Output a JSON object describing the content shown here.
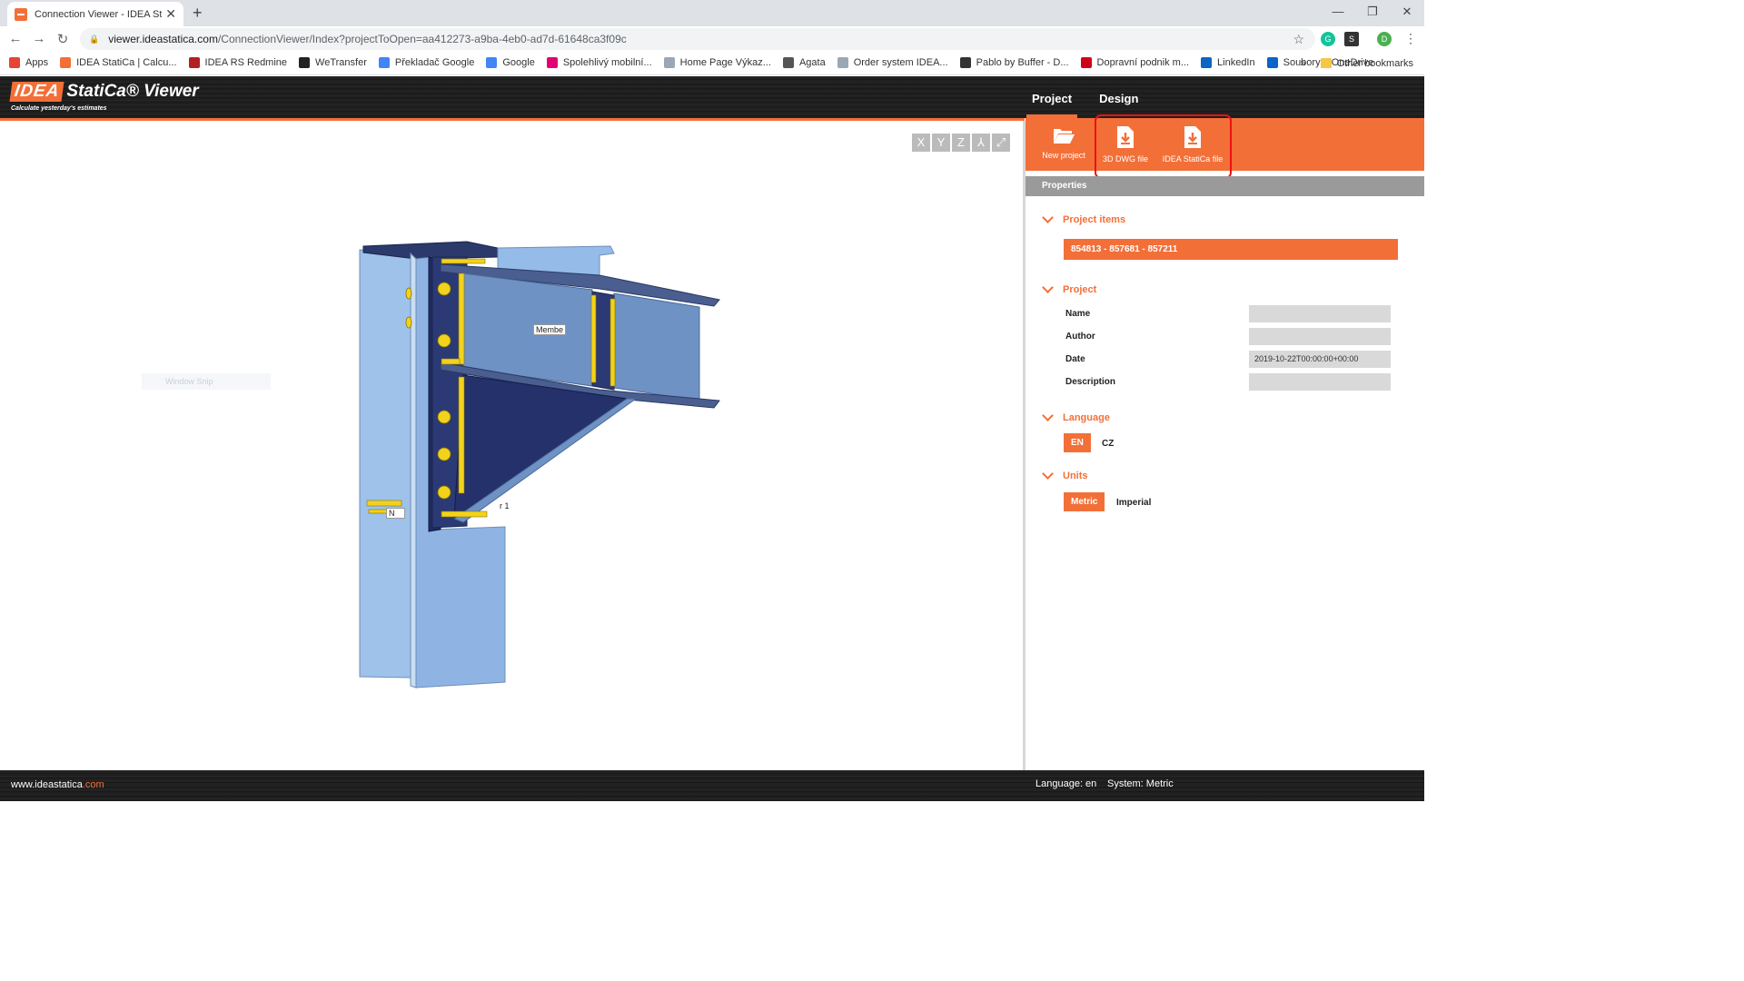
{
  "browser": {
    "tab_title": "Connection Viewer - IDEA StatiC",
    "url_host": "viewer.ideastatica.com",
    "url_path": "/ConnectionViewer/Index?projectToOpen=aa412273-a9ba-4eb0-ad7d-61648ca3f09c",
    "profile_initial": "D",
    "bookmarks": [
      {
        "label": "Apps",
        "icon": "apps-grid-icon",
        "color": "#e94235"
      },
      {
        "label": "IDEA StatiCa | Calcu...",
        "icon": "idea-icon",
        "color": "#f36f38"
      },
      {
        "label": "IDEA RS Redmine",
        "icon": "redmine-icon",
        "color": "#b32024"
      },
      {
        "label": "WeTransfer",
        "icon": "wetransfer-icon",
        "color": "#222222"
      },
      {
        "label": "Překladač Google",
        "icon": "google-translate-icon",
        "color": "#4285f4"
      },
      {
        "label": "Google",
        "icon": "google-icon",
        "color": "#4285f4"
      },
      {
        "label": "Spolehlivý mobilní...",
        "icon": "tmobile-icon",
        "color": "#e20074"
      },
      {
        "label": "Home Page Výkaz...",
        "icon": "page-icon",
        "color": "#9aa7b5"
      },
      {
        "label": "Agata",
        "icon": "agata-icon",
        "color": "#555555"
      },
      {
        "label": "Order system IDEA...",
        "icon": "page-icon",
        "color": "#9aa7b5"
      },
      {
        "label": "Pablo by Buffer - D...",
        "icon": "pablo-icon",
        "color": "#333333"
      },
      {
        "label": "Dopravní podnik m...",
        "icon": "dp-icon",
        "color": "#d0021b"
      },
      {
        "label": "LinkedIn",
        "icon": "linkedin-icon",
        "color": "#0a66c2"
      },
      {
        "label": "Soubory – OneDrive",
        "icon": "onedrive-icon",
        "color": "#0a64c9"
      }
    ],
    "more_bookmarks": "»",
    "other_bookmarks": "Other bookmarks"
  },
  "app": {
    "logo_idea": "IDEA",
    "logo_statica": "StatiCa® Viewer",
    "logo_tagline": "Calculate yesterday's estimates",
    "menu": [
      {
        "label": "Project",
        "active": true
      },
      {
        "label": "Design",
        "active": false
      }
    ]
  },
  "viewport": {
    "axis_buttons": [
      "X",
      "Y",
      "Z",
      "⅄",
      "⤢"
    ],
    "snip_text": "Window Snip",
    "labels": {
      "member_top": "Membe",
      "member_side": "r 1",
      "member_left": "N"
    }
  },
  "ribbon": {
    "new_project": "New project",
    "dwg_file": "3D DWG file",
    "idea_file": "IDEA StatiCa file"
  },
  "properties": {
    "header": "Properties",
    "project_items_title": "Project items",
    "project_item": "854813 - 857681 - 857211",
    "project_title": "Project",
    "fields": [
      {
        "label": "Name",
        "value": ""
      },
      {
        "label": "Author",
        "value": ""
      },
      {
        "label": "Date",
        "value": "2019-10-22T00:00:00+00:00"
      },
      {
        "label": "Description",
        "value": ""
      }
    ],
    "language_title": "Language",
    "languages": [
      {
        "label": "EN",
        "selected": true
      },
      {
        "label": "CZ",
        "selected": false
      }
    ],
    "units_title": "Units",
    "units": [
      {
        "label": "Metric",
        "selected": true
      },
      {
        "label": "Imperial",
        "selected": false
      }
    ]
  },
  "footer": {
    "site_prefix": "www.ideastatica",
    "site_suffix": ".com",
    "language_status": "Language: en",
    "system_status": "System: Metric"
  },
  "colors": {
    "accent": "#f36f38",
    "highlight": "#e11111"
  }
}
